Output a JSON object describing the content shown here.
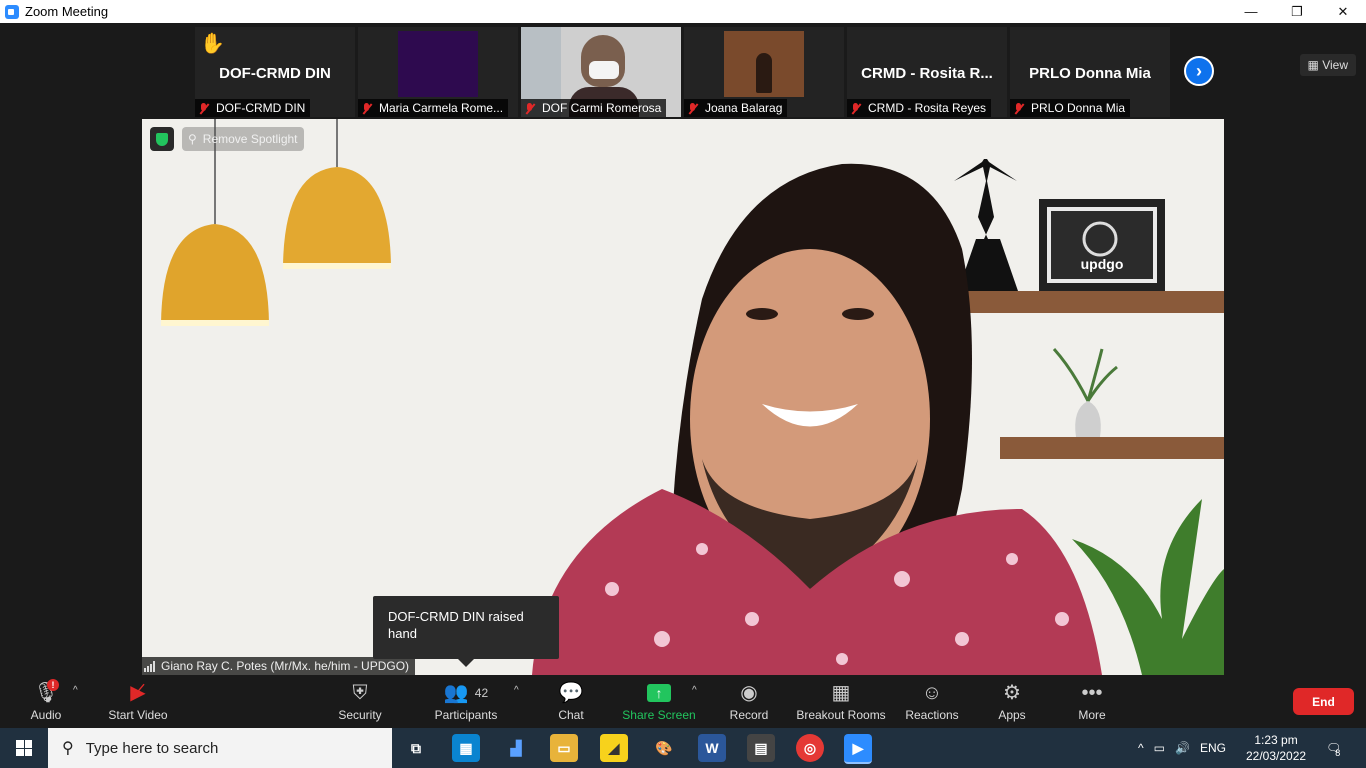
{
  "window": {
    "title": "Zoom Meeting",
    "controls": {
      "minimize": "—",
      "maximize": "❐",
      "close": "✕"
    }
  },
  "participants_strip": [
    {
      "big_name": "DOF-CRMD DIN",
      "label": "DOF-CRMD DIN",
      "raised_hand": true
    },
    {
      "big_name": "",
      "label": "Maria Carmela Rome...",
      "tile_color": "#2e0a4f"
    },
    {
      "big_name": "",
      "label": "DOF Carmi Romerosa"
    },
    {
      "big_name": "",
      "label": "Joana Balarag"
    },
    {
      "big_name": "CRMD - Rosita R...",
      "label": "CRMD - Rosita Reyes"
    },
    {
      "big_name": "PRLO Donna Mia",
      "label": "PRLO Donna Mia"
    }
  ],
  "view_button": "View",
  "next_icon": "chevron-right-icon",
  "spotlight": {
    "remove_label": "Remove Spotlight"
  },
  "speaker": {
    "name": "Giano Ray C. Potes (Mr/Mx. he/him - UPDGO)"
  },
  "poster_text": "updgo",
  "tooltip": {
    "text": "DOF-CRMD DIN raised hand"
  },
  "toolbar": {
    "audio": "Audio",
    "audio_badge": "!",
    "start_video": "Start Video",
    "security": "Security",
    "participants": "Participants",
    "participants_count": "42",
    "chat": "Chat",
    "share_screen": "Share Screen",
    "record": "Record",
    "breakout_rooms": "Breakout Rooms",
    "reactions": "Reactions",
    "apps": "Apps",
    "more": "More",
    "end": "End"
  },
  "colors": {
    "share_green": "#22c55e",
    "end_red": "#e02828",
    "accent_blue": "#0e72ed"
  },
  "taskbar": {
    "search_placeholder": "Type here to search",
    "language": "ENG",
    "time": "1:23 pm",
    "date": "22/03/2022",
    "notification_count": "8"
  }
}
